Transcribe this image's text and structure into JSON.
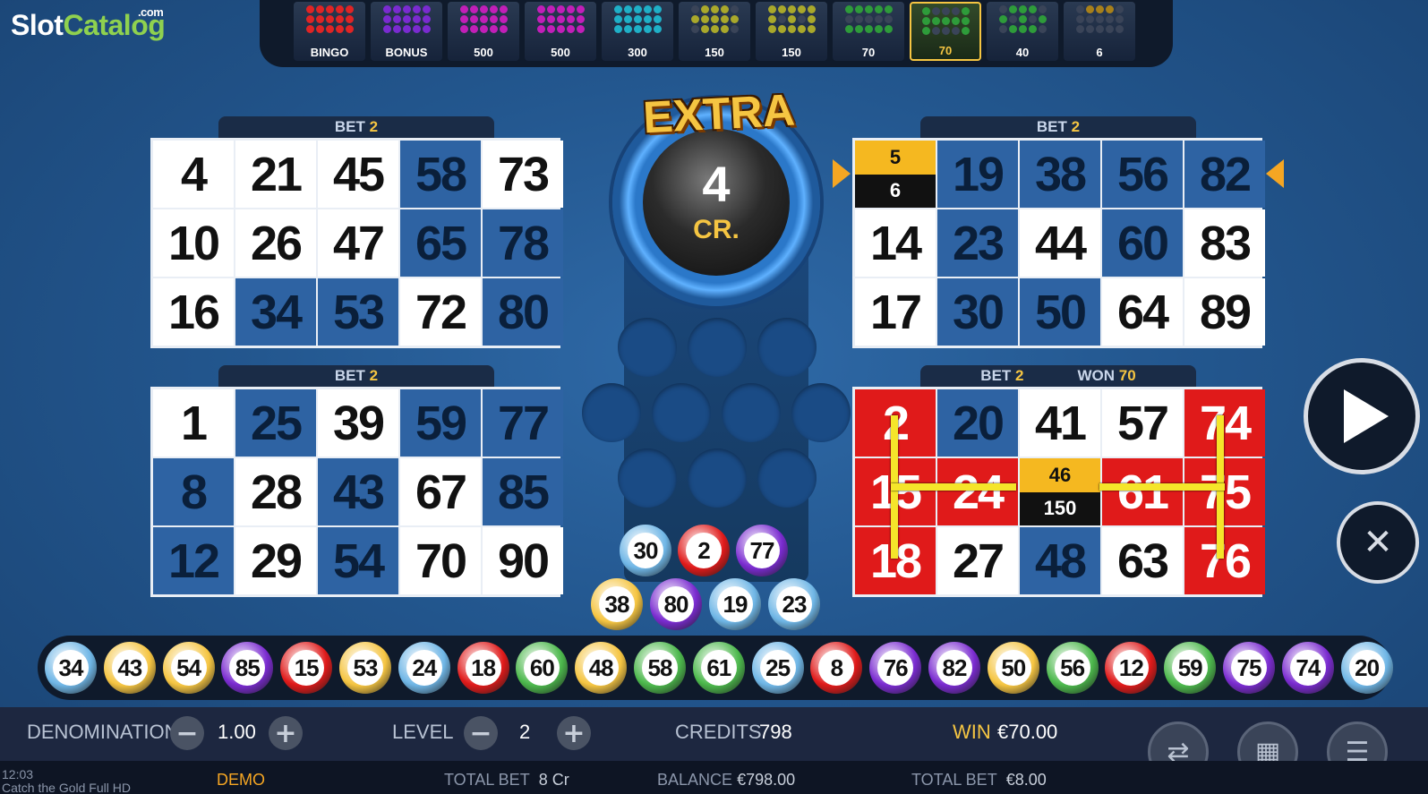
{
  "logo": {
    "slot": "Slot",
    "catalog": "Catalog",
    "com": ".com"
  },
  "paytable": [
    {
      "label": "BINGO",
      "color": "#e02424",
      "dots": [
        1,
        1,
        1,
        1,
        1,
        1,
        1,
        1,
        1,
        1,
        1,
        1,
        1,
        1,
        1
      ]
    },
    {
      "label": "BONUS",
      "color": "#7a2bd0",
      "dots": [
        1,
        1,
        1,
        1,
        1,
        1,
        1,
        1,
        1,
        1,
        1,
        1,
        1,
        1,
        1
      ]
    },
    {
      "label": "500",
      "color": "#c21fb8",
      "dots": [
        1,
        1,
        1,
        1,
        1,
        1,
        1,
        1,
        1,
        1,
        1,
        1,
        1,
        1,
        1
      ]
    },
    {
      "label": "500",
      "color": "#c21fb8",
      "dots": [
        1,
        1,
        1,
        1,
        1,
        1,
        1,
        1,
        1,
        1,
        1,
        1,
        1,
        1,
        1
      ]
    },
    {
      "label": "300",
      "color": "#1fb0c7",
      "dots": [
        1,
        1,
        1,
        1,
        1,
        1,
        1,
        1,
        1,
        1,
        1,
        1,
        1,
        1,
        1
      ]
    },
    {
      "label": "150",
      "color": "#a9a82b",
      "dots": [
        0,
        1,
        1,
        1,
        0,
        1,
        1,
        1,
        1,
        1,
        0,
        1,
        1,
        1,
        0
      ]
    },
    {
      "label": "150",
      "color": "#a9a82b",
      "dots": [
        1,
        1,
        1,
        1,
        1,
        1,
        0,
        1,
        0,
        1,
        1,
        1,
        1,
        1,
        1
      ]
    },
    {
      "label": "70",
      "color": "#2e9b3a",
      "dots": [
        1,
        1,
        1,
        1,
        1,
        0,
        0,
        0,
        0,
        0,
        1,
        1,
        1,
        1,
        1
      ]
    },
    {
      "label": "70",
      "color": "#2e9b3a",
      "dots": [
        1,
        0,
        0,
        0,
        1,
        1,
        1,
        1,
        1,
        1,
        1,
        0,
        0,
        0,
        1
      ],
      "active": true
    },
    {
      "label": "40",
      "color": "#2e9b3a",
      "dots": [
        0,
        1,
        1,
        1,
        0,
        1,
        0,
        1,
        0,
        1,
        0,
        1,
        1,
        1,
        0
      ]
    },
    {
      "label": "6",
      "color": "#a8801a",
      "dots": [
        0,
        1,
        1,
        1,
        0,
        0,
        0,
        0,
        0,
        0,
        0,
        0,
        0,
        0,
        0
      ]
    }
  ],
  "cards": [
    {
      "bet_label": "BET",
      "bet_value": "2",
      "won_label": "",
      "won_value": "",
      "cells": [
        {
          "n": "4",
          "s": "w"
        },
        {
          "n": "21",
          "s": "w"
        },
        {
          "n": "45",
          "s": "w"
        },
        {
          "n": "58",
          "s": "b"
        },
        {
          "n": "73",
          "s": "w"
        },
        {
          "n": "10",
          "s": "w"
        },
        {
          "n": "26",
          "s": "w"
        },
        {
          "n": "47",
          "s": "w"
        },
        {
          "n": "65",
          "s": "b"
        },
        {
          "n": "78",
          "s": "b"
        },
        {
          "n": "16",
          "s": "w"
        },
        {
          "n": "34",
          "s": "b"
        },
        {
          "n": "53",
          "s": "b"
        },
        {
          "n": "72",
          "s": "w"
        },
        {
          "n": "80",
          "s": "b"
        }
      ]
    },
    {
      "bet_label": "BET",
      "bet_value": "2",
      "won_label": "",
      "won_value": "",
      "cells": [
        {
          "n": "",
          "s": "prog",
          "top": "5",
          "bot": "6"
        },
        {
          "n": "19",
          "s": "b"
        },
        {
          "n": "38",
          "s": "b"
        },
        {
          "n": "56",
          "s": "b"
        },
        {
          "n": "82",
          "s": "b"
        },
        {
          "n": "14",
          "s": "w"
        },
        {
          "n": "23",
          "s": "b"
        },
        {
          "n": "44",
          "s": "w"
        },
        {
          "n": "60",
          "s": "b"
        },
        {
          "n": "83",
          "s": "w"
        },
        {
          "n": "17",
          "s": "w"
        },
        {
          "n": "30",
          "s": "b"
        },
        {
          "n": "50",
          "s": "b"
        },
        {
          "n": "64",
          "s": "w"
        },
        {
          "n": "89",
          "s": "w"
        }
      ],
      "arrow_label": "1"
    },
    {
      "bet_label": "BET",
      "bet_value": "2",
      "won_label": "",
      "won_value": "",
      "cells": [
        {
          "n": "1",
          "s": "w"
        },
        {
          "n": "25",
          "s": "b"
        },
        {
          "n": "39",
          "s": "w"
        },
        {
          "n": "59",
          "s": "b"
        },
        {
          "n": "77",
          "s": "b"
        },
        {
          "n": "8",
          "s": "b"
        },
        {
          "n": "28",
          "s": "w"
        },
        {
          "n": "43",
          "s": "b"
        },
        {
          "n": "67",
          "s": "w"
        },
        {
          "n": "85",
          "s": "b"
        },
        {
          "n": "12",
          "s": "b"
        },
        {
          "n": "29",
          "s": "w"
        },
        {
          "n": "54",
          "s": "b"
        },
        {
          "n": "70",
          "s": "w"
        },
        {
          "n": "90",
          "s": "w"
        }
      ]
    },
    {
      "bet_label": "BET",
      "bet_value": "2",
      "won_label": "WON",
      "won_value": "70",
      "cells": [
        {
          "n": "2",
          "s": "r"
        },
        {
          "n": "20",
          "s": "b"
        },
        {
          "n": "41",
          "s": "w"
        },
        {
          "n": "57",
          "s": "w"
        },
        {
          "n": "74",
          "s": "r"
        },
        {
          "n": "15",
          "s": "r"
        },
        {
          "n": "24",
          "s": "r"
        },
        {
          "n": "",
          "s": "prog",
          "top": "46",
          "bot": "150"
        },
        {
          "n": "61",
          "s": "r"
        },
        {
          "n": "75",
          "s": "r"
        },
        {
          "n": "18",
          "s": "r"
        },
        {
          "n": "27",
          "s": "w"
        },
        {
          "n": "48",
          "s": "b"
        },
        {
          "n": "63",
          "s": "w"
        },
        {
          "n": "76",
          "s": "r"
        }
      ]
    }
  ],
  "extra": {
    "title": "EXTRA",
    "value": "4",
    "unit": "CR."
  },
  "extra_balls_row1": [
    {
      "n": "30",
      "c": "#6fb6e6"
    },
    {
      "n": "2",
      "c": "#e01a1a"
    },
    {
      "n": "77",
      "c": "#7a2bd0"
    }
  ],
  "extra_balls_row2": [
    {
      "n": "38",
      "c": "#f5c542"
    },
    {
      "n": "80",
      "c": "#7a2bd0"
    },
    {
      "n": "19",
      "c": "#6fb6e6"
    },
    {
      "n": "23",
      "c": "#6fb6e6"
    }
  ],
  "drawn_balls": [
    {
      "n": "34",
      "c": "#6fb6e6"
    },
    {
      "n": "43",
      "c": "#f5c542"
    },
    {
      "n": "54",
      "c": "#f5c542"
    },
    {
      "n": "85",
      "c": "#7a2bd0"
    },
    {
      "n": "15",
      "c": "#e01a1a"
    },
    {
      "n": "53",
      "c": "#f5c542"
    },
    {
      "n": "24",
      "c": "#6fb6e6"
    },
    {
      "n": "18",
      "c": "#e01a1a"
    },
    {
      "n": "60",
      "c": "#4cb84c"
    },
    {
      "n": "48",
      "c": "#f5c542"
    },
    {
      "n": "58",
      "c": "#4cb84c"
    },
    {
      "n": "61",
      "c": "#4cb84c"
    },
    {
      "n": "25",
      "c": "#6fb6e6"
    },
    {
      "n": "8",
      "c": "#e01a1a"
    },
    {
      "n": "76",
      "c": "#7a2bd0"
    },
    {
      "n": "82",
      "c": "#7a2bd0"
    },
    {
      "n": "50",
      "c": "#f5c542"
    },
    {
      "n": "56",
      "c": "#4cb84c"
    },
    {
      "n": "12",
      "c": "#e01a1a"
    },
    {
      "n": "59",
      "c": "#4cb84c"
    },
    {
      "n": "75",
      "c": "#7a2bd0"
    },
    {
      "n": "74",
      "c": "#7a2bd0"
    },
    {
      "n": "20",
      "c": "#6fb6e6"
    }
  ],
  "controls": {
    "denomination_label": "DENOMINATION",
    "denomination_value": "1.00",
    "level_label": "LEVEL",
    "level_value": "2",
    "credits_label": "CREDITS",
    "credits_value": "798",
    "win_label": "WIN",
    "win_value": "€70.00",
    "minus": "−",
    "plus": "+"
  },
  "info": {
    "time": "12:03",
    "game_title": "Catch the Gold Full HD",
    "demo": "DEMO",
    "total_bet_cr_label": "TOTAL BET",
    "total_bet_cr_value": "8 Cr",
    "balance_label": "BALANCE",
    "balance_value": "€798.00",
    "total_bet_label": "TOTAL BET",
    "total_bet_value": "€8.00"
  },
  "icons": {
    "play": "play-icon",
    "close": "close-icon",
    "swap": "swap-cards-icon",
    "keypad": "keypad-icon",
    "menu": "menu-icon"
  }
}
